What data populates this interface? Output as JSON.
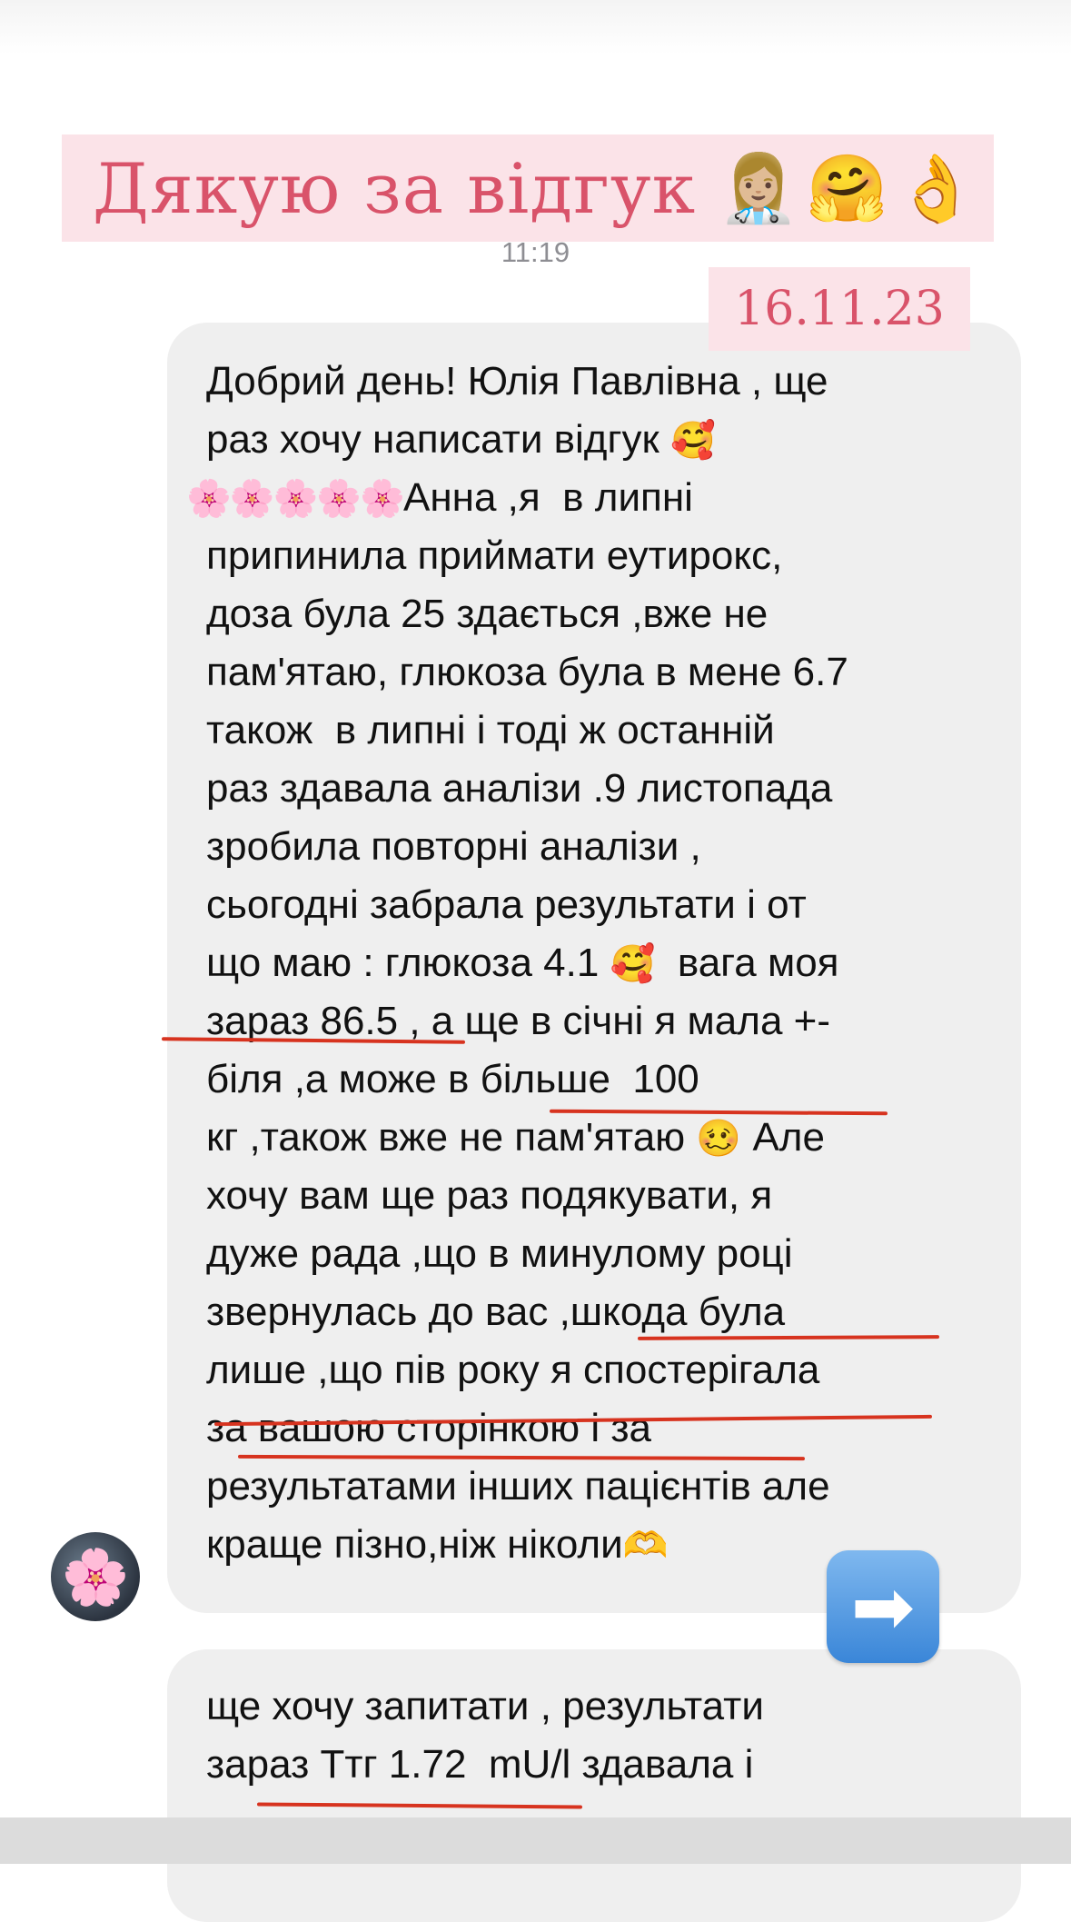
{
  "banner": {
    "text": "Дякую за відгук",
    "emojis": [
      "👩🏼‍⚕️",
      "🤗",
      "👌"
    ]
  },
  "time": "11:19",
  "date_badge": "16.11.23",
  "message_main": {
    "lines": [
      "Добрий день! Юлія Павлівна , ще",
      "раз хочу написати відгук",
      "Анна ,я  в липні",
      "припинила приймати еутирокс,",
      "доза була 25 здається ,вже не",
      "пам'ятаю, глюкоза була в мене 6.7",
      "також  в липні і тоді ж останній",
      "раз здавала аналізи .9 листопада",
      "зробила повторні аналізи ,",
      "сьогодні забрала результати і от",
      "що маю : глюкоза 4.1",
      "вага моя",
      "зараз 86.5 , а ще в січні я мала +-",
      "біля ,а може в більше  100",
      "кг ,також вже не пам'ятаю",
      "Але",
      "хочу вам ще раз подякувати, я",
      "дуже рада ,що в минулому році",
      "звернулась до вас ,шкода була",
      "лише ,що пів року я спостерігала",
      "за вашою сторінкою і за",
      "результатами інших пацієнтів але",
      "краще пізно,ніж ніколи"
    ],
    "emojis": {
      "smiling_hearts": "🥰",
      "flowers": "🌸🌸🌸🌸🌸",
      "woozy": "🥴",
      "heart_hands": "🫶"
    }
  },
  "message_second": {
    "lines": [
      "ще хочу запитати , результати",
      "зараз Ттг 1.72  mU/l здавала і"
    ]
  },
  "avatar": {
    "emoji": "🌸"
  },
  "arrow_button": {
    "glyph": "➡"
  },
  "colors": {
    "banner_bg": "#fbe3e8",
    "banner_text": "#d9536a",
    "underline": "#d7331f",
    "bubble": "#efefef",
    "arrow_button": "#3a86d8"
  }
}
